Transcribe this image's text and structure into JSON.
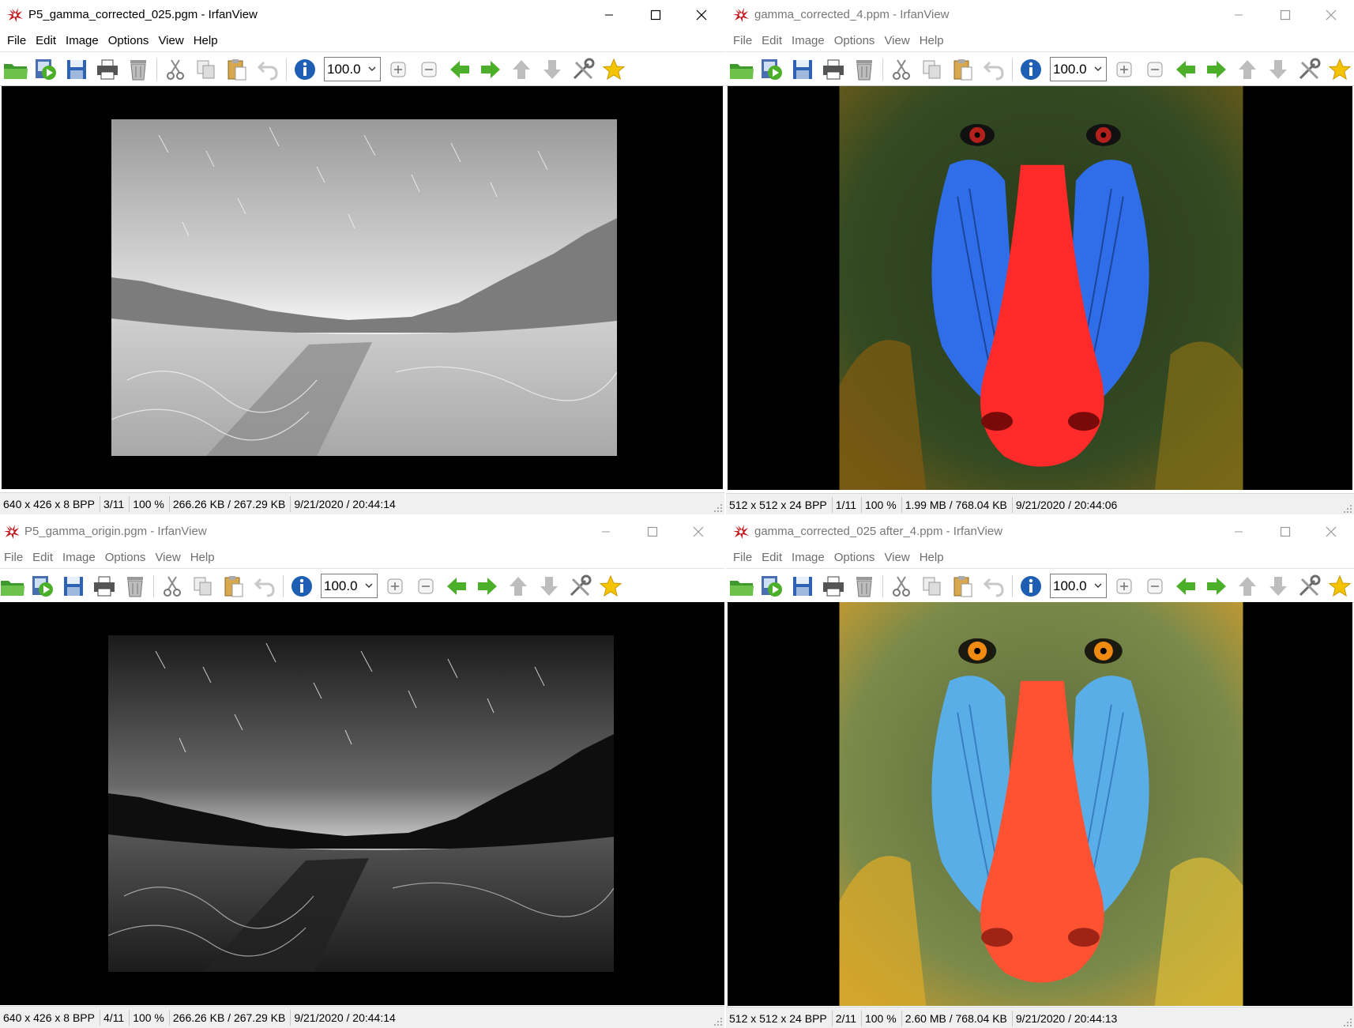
{
  "windows": {
    "top_left": {
      "title": "P5_gamma_corrected_025.pgm - IrfanView",
      "active": true,
      "zoom": "100.0",
      "status": [
        "640 x 426 x 8 BPP",
        "3/11",
        "100 %",
        "266.26 KB / 267.29 KB",
        "9/21/2020 / 20:44:14"
      ]
    },
    "top_right": {
      "title": "gamma_corrected_4.ppm - IrfanView",
      "active": false,
      "zoom": "100.0",
      "status": [
        "512 x 512 x 24 BPP",
        "1/11",
        "100 %",
        "1.99 MB / 768.04 KB",
        "9/21/2020 / 20:44:06"
      ]
    },
    "bottom_left": {
      "title": "P5_gamma_origin.pgm - IrfanView",
      "active": false,
      "zoom": "100.0",
      "status": [
        "640 x 426 x 8 BPP",
        "4/11",
        "100 %",
        "266.26 KB / 267.29 KB",
        "9/21/2020 / 20:44:14"
      ]
    },
    "bottom_right": {
      "title": "gamma_corrected_025 after_4.ppm - IrfanView",
      "active": false,
      "zoom": "100.0",
      "status": [
        "512 x 512 x 24 BPP",
        "2/11",
        "100 %",
        "2.60 MB / 768.04 KB",
        "9/21/2020 / 20:44:13"
      ]
    }
  },
  "menu": [
    "File",
    "Edit",
    "Image",
    "Options",
    "View",
    "Help"
  ],
  "icons": [
    "open-folder-icon",
    "slideshow-icon",
    "save-icon",
    "print-icon",
    "delete-icon",
    "cut-icon",
    "copy-icon",
    "paste-icon",
    "undo-icon",
    "info-icon",
    "zoom-in-icon",
    "zoom-out-icon",
    "previous-icon",
    "next-icon",
    "up-icon",
    "down-icon",
    "settings-icon",
    "favorite-icon"
  ],
  "colors": {
    "toolbar_green": "#4caf2a",
    "info_blue": "#1e5fb3",
    "star_yellow": "#f5c400",
    "mandrill_red_bright": "#ff2a2a",
    "mandrill_blue_dark": "#2f6ee8"
  }
}
